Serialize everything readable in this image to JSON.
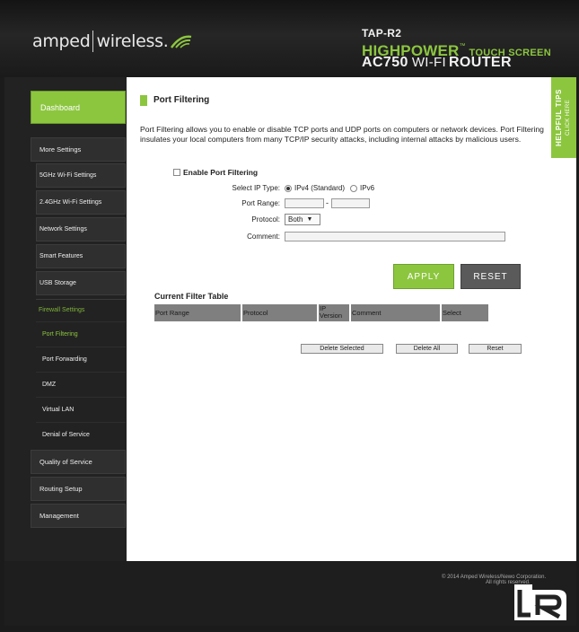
{
  "header": {
    "brand_left": "amped",
    "brand_right": "wireless.",
    "model": "TAP-R2",
    "highpower": "HIGHPOWER",
    "tm": "™",
    "touch": "TOUCH SCREEN",
    "ac": "AC750",
    "wifi": "WI-FI",
    "router": "ROUTER"
  },
  "helpful_tips": {
    "title": "HELPFUL TIPS",
    "sub": "CLICK HERE"
  },
  "nav": {
    "dashboard": "Dashboard",
    "more_settings": "More Settings",
    "items": [
      "5GHz Wi-Fi Settings",
      "2.4GHz Wi-Fi Settings",
      "Network Settings",
      "Smart Features",
      "USB Storage"
    ],
    "firewall": "Firewall Settings",
    "firewall_sub": [
      "Port Filtering",
      "Port Forwarding",
      "DMZ",
      "Virtual LAN",
      "Denial of Service"
    ],
    "bottom": [
      "Quality of Service",
      "Routing Setup",
      "Management"
    ]
  },
  "page": {
    "title": "Port Filtering",
    "description": "Port Filtering allows you to enable or disable TCP ports and UDP ports on computers or network devices. Port Filtering insulates your local computers from many TCP/IP security attacks, including internal attacks by malicious users.",
    "enable_label": "Enable Port Filtering",
    "ip_type_label": "Select IP Type:",
    "ipv4_label": "IPv4 (Standard)",
    "ipv6_label": "IPv6",
    "ip_type_selected": "IPv4 (Standard)",
    "port_range_label": "Port Range:",
    "port_from": "",
    "port_to": "",
    "dash": "-",
    "protocol_label": "Protocol:",
    "protocol_value": "Both",
    "comment_label": "Comment:",
    "comment_value": "",
    "apply": "APPLY",
    "reset": "RESET",
    "table_title": "Current Filter Table",
    "columns": [
      "Port Range",
      "Protocol",
      "IP Version",
      "Comment",
      "Select"
    ],
    "delete_selected": "Delete Selected",
    "delete_all": "Delete All",
    "reset_small": "Reset"
  },
  "footer": {
    "copyright": "© 2014 Amped Wireless/Newo Corporation.",
    "rights": "All rights reserved."
  },
  "colors": {
    "accent": "#8cc63f",
    "dark": "#222222"
  }
}
